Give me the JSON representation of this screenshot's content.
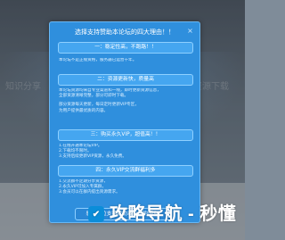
{
  "background": {
    "left_text": "知识分享",
    "right_text": "资源下载"
  },
  "modal": {
    "title": "选择支持赞助本论坛的四大理由！！",
    "close_glyph": "×",
    "sections": [
      {
        "heading": "一：稳定性高，不跑路！！",
        "lines": [
          "本论坛不是正规资格，服务器已运营十年。"
        ]
      },
      {
        "heading": "二：资源更新快，质量高",
        "lines": [
          "本论坛资源均来自专业渠道和一线，即时更新资源信息，",
          "全部资源清晰完整，部分可即时下载。",
          "部分资源每天更新，每日定时更新VIP专区，",
          "为用户提供最优质的内容。"
        ]
      },
      {
        "heading": "三：购买永久VIP，超值高！！",
        "lines": [
          "1.在线开通本论坛VIP。",
          "2.下载均不限时。",
          "3.支持后续更新VIP资源，永久免费。"
        ]
      },
      {
        "heading": "四：永久VIP交流群福利多",
        "lines": [
          "1.交流群不定期分享资源，",
          "2.永久VIP可加入专属群，",
          "3.会员可以在群内提出资源需求。"
        ]
      }
    ],
    "cta_label": "感谢每位支持赞助本论坛的朗友！"
  },
  "watermark": {
    "logo_glyph": "✔",
    "text": "攻略导航 - 秒懂"
  },
  "colors": {
    "modal_bg": "#2f8fdd",
    "section_head_bg": "#45a6f0",
    "accent_border": "#8ed0ff"
  }
}
